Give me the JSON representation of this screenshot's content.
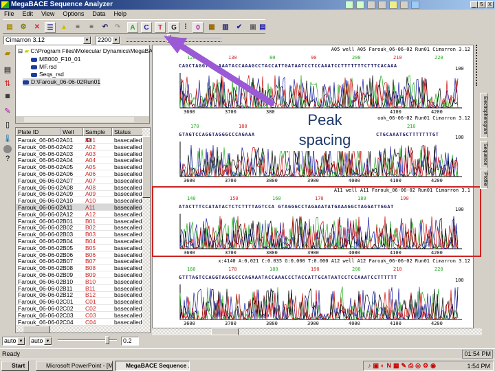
{
  "window": {
    "title": "MegaBACE Sequence Analyzer",
    "controls": [
      "_",
      "5",
      "X"
    ]
  },
  "menu": [
    "File",
    "Edit",
    "View",
    "Options",
    "Data",
    "Help"
  ],
  "toolbar": {
    "base_buttons": [
      "A",
      "C",
      "T",
      "G"
    ],
    "open_label": "0"
  },
  "combos": {
    "project": "Cimarron 3.12",
    "zoom": "2200"
  },
  "tree": {
    "nodes": [
      "C:\\Program Files\\Molecular Dynamics\\MegaBACE\\D",
      "MB000_F10_01",
      "MF.rsd",
      "Seqs_rsd",
      "D:\\Farouk_06-06-02Run01"
    ]
  },
  "table": {
    "columns": [
      "Plate ID",
      "Well",
      "Sample ID",
      "Status"
    ],
    "selected_index": 10,
    "rows": [
      [
        "Farouk_06-06-02",
        "A01",
        "A01",
        "basecalled"
      ],
      [
        "Farouk_06-06-02",
        "A02",
        "A02",
        "basecalled"
      ],
      [
        "Farouk_06-06-02",
        "A03",
        "A03",
        "basecalled"
      ],
      [
        "Farouk_06-06-02",
        "A04",
        "A04",
        "basecalled"
      ],
      [
        "Farouk_06-06-02",
        "A05",
        "A05",
        "basecalled"
      ],
      [
        "Farouk_06-06-02",
        "A06",
        "A06",
        "basecalled"
      ],
      [
        "Farouk_06-06-02",
        "A07",
        "A07",
        "basecalled"
      ],
      [
        "Farouk_06-06-02",
        "A08",
        "A08",
        "basecalled"
      ],
      [
        "Farouk_06-06-02",
        "A09",
        "A09",
        "basecalled"
      ],
      [
        "Farouk_06-06-02",
        "A10",
        "A10",
        "basecalled"
      ],
      [
        "Farouk_06-06-02",
        "A11",
        "A11",
        "basecalled"
      ],
      [
        "Farouk_06-06-02",
        "A12",
        "A12",
        "basecalled"
      ],
      [
        "Farouk_06-06-02",
        "B01",
        "B01",
        "basecalled"
      ],
      [
        "Farouk_06-06-02",
        "B02",
        "B02",
        "basecalled"
      ],
      [
        "Farouk_06-06-02",
        "B03",
        "B03",
        "basecalled"
      ],
      [
        "Farouk_06-06-02",
        "B04",
        "B04",
        "basecalled"
      ],
      [
        "Farouk_06-06-02",
        "B05",
        "B05",
        "basecalled"
      ],
      [
        "Farouk_06-06-02",
        "B06",
        "B06",
        "basecalled"
      ],
      [
        "Farouk_06-06-02",
        "B07",
        "B07",
        "basecalled"
      ],
      [
        "Farouk_06-06-02",
        "B08",
        "B08",
        "basecalled"
      ],
      [
        "Farouk_06-06-02",
        "B09",
        "B09",
        "basecalled"
      ],
      [
        "Farouk_06-06-02",
        "B10",
        "B10",
        "basecalled"
      ],
      [
        "Farouk_06-06-02",
        "B11",
        "B11",
        "basecalled"
      ],
      [
        "Farouk_06-06-02",
        "B12",
        "B12",
        "basecalled"
      ],
      [
        "Farouk_06-06-02",
        "C01",
        "C01",
        "basecalled"
      ],
      [
        "Farouk_06-06-02",
        "C02",
        "C02",
        "basecalled"
      ],
      [
        "Farouk_06-06-02",
        "C03",
        "C03",
        "basecalled"
      ],
      [
        "Farouk_06-06-02",
        "C04",
        "C04",
        "basecalled"
      ]
    ]
  },
  "panels": [
    {
      "header": "A05 well A05 Farouk_06-06-02 Run01 Cimarron 3.12",
      "positions": [
        "120",
        "130",
        "80",
        "90",
        "200",
        "210",
        "220"
      ],
      "sequence": "CAGCTAGGTCA AAATACCAAAGCCTACCATTGATAATCCTCCAAATCCTTTTTTTCTTTCACAAA",
      "scale": "100",
      "x_ticks": [
        "3600",
        "3700",
        "3800",
        "3900",
        "4000",
        "4100",
        "4200"
      ],
      "highlighted": false
    },
    {
      "header": "ook_06-06-02 Run01 Cimarron 3.12",
      "positions": [
        "170",
        "180",
        "210"
      ],
      "sequence": "GTAGTCCAGGTAGGGCCCAGAAA",
      "sequence2": "CTGCAAATGCTTTTTTTGT",
      "scale": "100",
      "x_ticks": [
        "3600",
        "3700",
        "3800",
        "3900",
        "4000",
        "4100",
        "4200"
      ],
      "highlighted": false
    },
    {
      "header": "A11 well A11 Farouk_06-06-02 Run01 Cimarron 3.1",
      "positions": [
        "140",
        "150",
        "160",
        "170",
        "180",
        "190"
      ],
      "sequence": "ATACTTTCCATATACTCTCTTTTAGTCCA GTAGGGCCTAGAAATATGAAAGGCTAGGATTGGAT",
      "scale": "100",
      "x_ticks": [
        "3600",
        "3700",
        "3800",
        "3900",
        "4000",
        "4100",
        "4200"
      ],
      "highlighted": true
    },
    {
      "header": "x:4140 A:0.021 C:0.035 G:0.000 T:0.000   A12 well A12 Farouk_06-06-02 Run01 Cimarron 3.12",
      "positions": [
        "160",
        "170",
        "180",
        "190",
        "200",
        "210",
        "220"
      ],
      "sequence": "GTTTAGTCCAGGTAGGGCCCAGAAATACCAAACCCTACCATTGCATAATCCTCCAAATCCTTTTTT",
      "scale": "100",
      "x_ticks": [
        "3600",
        "3700",
        "3800",
        "3900",
        "4000",
        "4100",
        "4200"
      ],
      "highlighted": false
    }
  ],
  "annotation": {
    "line1": "Peak",
    "line2": "spacing",
    "arrow_color": "#9b59d6"
  },
  "right_tabs": [
    "Electropherogram",
    "Sequence",
    "Profile"
  ],
  "bottom_controls": {
    "combo1": "auto",
    "combo2": "auto",
    "value": "0.2"
  },
  "status": {
    "text": "Ready",
    "right": "01:54 PM"
  },
  "taskbar": {
    "start": "Start",
    "tasks": [
      "Microsoft PowerPoint - [M...",
      "MegaBACE Sequence ..."
    ],
    "clock": "1:54 PM"
  },
  "colors": {
    "A": "#22aa22",
    "C": "#1a1aa0",
    "G": "#000000",
    "T": "#cc1111",
    "highlight": "#cc2222",
    "title_start": "#0a246a"
  }
}
